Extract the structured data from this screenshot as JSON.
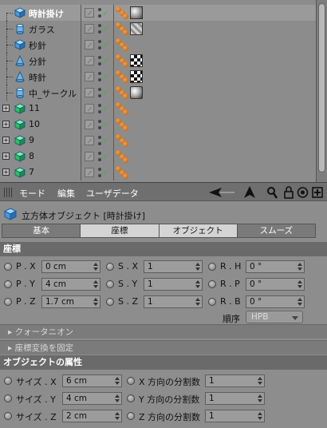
{
  "object_manager": {
    "rows": [
      {
        "name": "時計掛け",
        "icon": "cube-icon",
        "selected": true,
        "tag": "sphere-material-tag"
      },
      {
        "name": "ガラス",
        "icon": "cylinder-icon",
        "selected": false,
        "tag": "glass-material-tag"
      },
      {
        "name": "秒針",
        "icon": "cube-icon",
        "selected": false,
        "tag": ""
      },
      {
        "name": "分針",
        "icon": "cone-icon",
        "selected": false,
        "tag": "checker-material-tag"
      },
      {
        "name": "時針",
        "icon": "cone-icon",
        "selected": false,
        "tag": "checker-material-tag"
      },
      {
        "name": "中_サークル",
        "icon": "cylinder-icon",
        "selected": false,
        "tag": "sphere-material-tag"
      },
      {
        "name": "11",
        "icon": "group-icon",
        "selected": false,
        "tag": ""
      },
      {
        "name": "10",
        "icon": "group-icon",
        "selected": false,
        "tag": ""
      },
      {
        "name": "9",
        "icon": "group-icon",
        "selected": false,
        "tag": ""
      },
      {
        "name": "8",
        "icon": "group-icon",
        "selected": false,
        "tag": ""
      },
      {
        "name": "7",
        "icon": "group-icon",
        "selected": false,
        "tag": ""
      }
    ]
  },
  "attribute_manager": {
    "menu": {
      "mode": "モード",
      "edit": "編集",
      "user_data": "ユーザデータ"
    },
    "toolbar_icons": [
      "back-arrow-icon",
      "up-arrow-icon",
      "search-icon",
      "lock-icon",
      "target-icon",
      "new-window-icon"
    ],
    "object_title": "立方体オブジェクト [時計掛け]",
    "tabs": [
      "基本",
      "座標",
      "オブジェクト",
      "スムーズ"
    ],
    "active_tabs": [
      "座標",
      "オブジェクト"
    ],
    "coords_section": "座標",
    "coords": {
      "px_label": "P . X",
      "px": "0 cm",
      "py_label": "P . Y",
      "py": "4 cm",
      "pz_label": "P . Z",
      "pz": "1.7 cm",
      "sx_label": "S . X",
      "sx": "1",
      "sy_label": "S . Y",
      "sy": "1",
      "sz_label": "S . Z",
      "sz": "1",
      "rh_label": "R . H",
      "rh": "0 °",
      "rp_label": "R . P",
      "rp": "0 °",
      "rb_label": "R . B",
      "rb": "0 °"
    },
    "order_label": "順序",
    "order_value": "HPB",
    "quaternion": "クォータニオン",
    "freeze": "座標変換を固定",
    "object_section": "オブジェクトの属性",
    "object": {
      "size_x_label": "サイズ . X",
      "size_x": "6 cm",
      "size_y_label": "サイズ . Y",
      "size_y": "4 cm",
      "size_z_label": "サイズ . Z",
      "size_z": "2 cm",
      "seg_x_label": "X 方向の分割数",
      "seg_x": "1",
      "seg_y_label": "Y 方向の分割数",
      "seg_y": "1",
      "seg_z_label": "Z 方向の分割数",
      "seg_z": "1"
    }
  }
}
